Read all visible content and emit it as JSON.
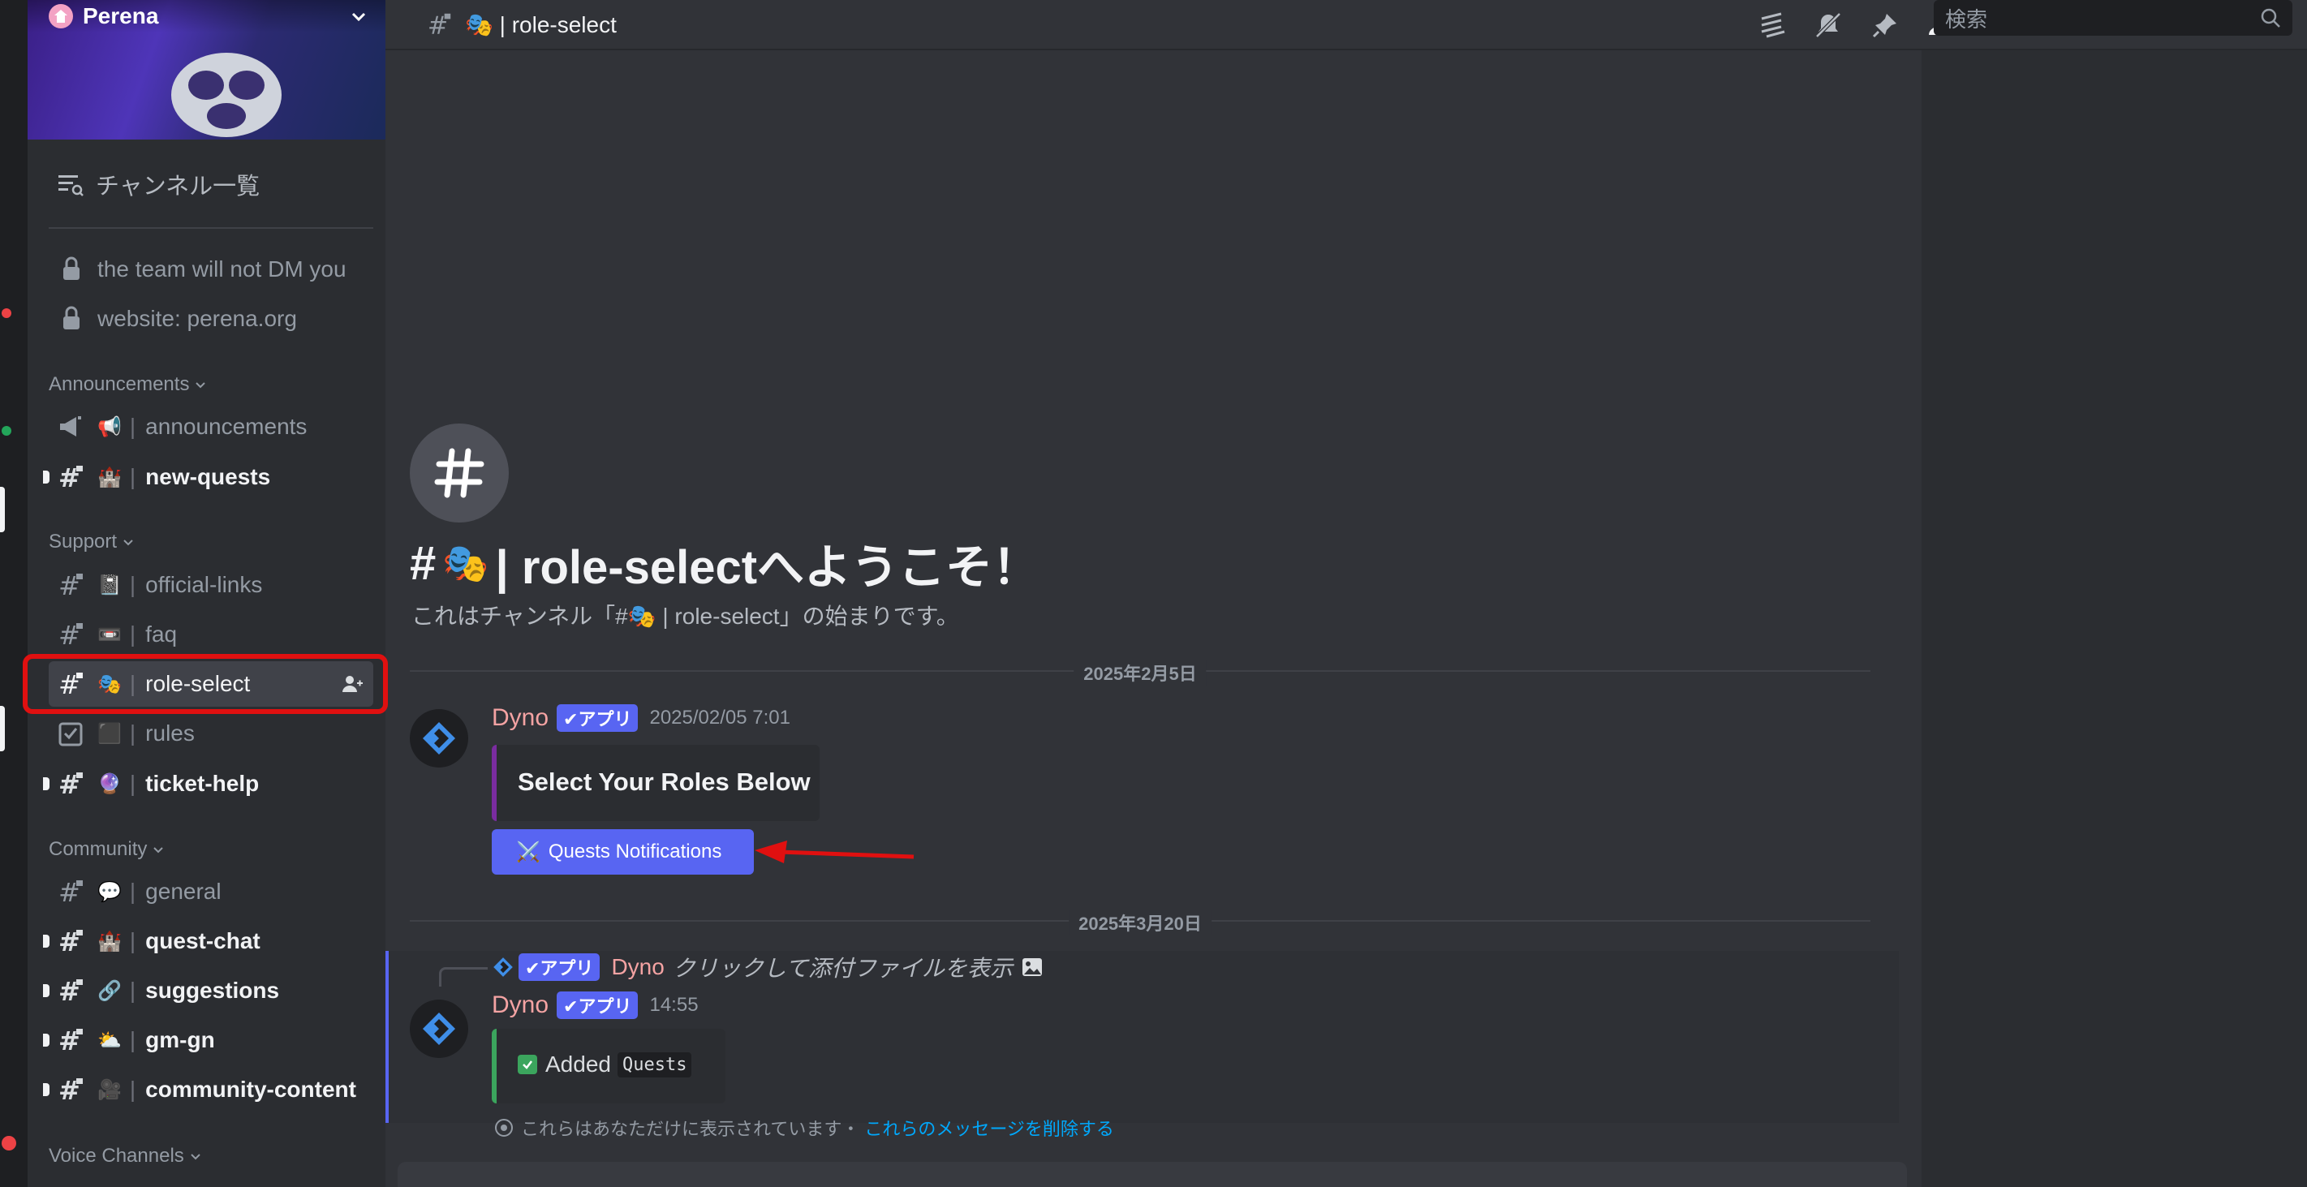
{
  "server": {
    "name": "Perena"
  },
  "sidebar": {
    "browse_label": "チャンネル一覧",
    "pinned": [
      {
        "label": "the team will not DM you"
      },
      {
        "label": "website: perena.org"
      }
    ],
    "categories": [
      {
        "label": "Announcements"
      },
      {
        "label": "Support"
      },
      {
        "label": "Community"
      },
      {
        "label": "Voice Channels"
      }
    ],
    "channels": [
      {
        "emoji": "📢",
        "label": "announcements"
      },
      {
        "emoji": "🏰",
        "label": "new-quests"
      },
      {
        "emoji": "📓",
        "label": "official-links"
      },
      {
        "emoji": "📼",
        "label": "faq"
      },
      {
        "emoji": "🎭",
        "label": "role-select"
      },
      {
        "emoji": "⬛",
        "label": "rules"
      },
      {
        "emoji": "🔮",
        "label": "ticket-help"
      },
      {
        "emoji": "💬",
        "label": "general"
      },
      {
        "emoji": "🏰",
        "label": "quest-chat"
      },
      {
        "emoji": "🔗",
        "label": "suggestions"
      },
      {
        "emoji": "⛅",
        "label": "gm-gn"
      },
      {
        "emoji": "🎥",
        "label": "community-content"
      }
    ],
    "separator": "|"
  },
  "topbar": {
    "channel_title": "🎭 | role-select",
    "search_placeholder": "検索"
  },
  "welcome": {
    "title_prefix": "#",
    "title_emoji": "🎭",
    "title_text": "| role-selectへようこそ！",
    "subtitle": "これはチャンネル「#🎭 | role-select」の始まりです。"
  },
  "messages": [
    {
      "date_divider": "2025年2月5日",
      "author": "Dyno",
      "badge": "✔アプリ",
      "timestamp": "2025/02/05 7:01",
      "embed_title": "Select Your Roles Below",
      "button_emoji": "⚔️",
      "button_label": "Quests Notifications"
    },
    {
      "date_divider": "2025年3月20日",
      "reply_author": "Dyno",
      "reply_badge": "✔アプリ",
      "reply_text": "クリックして添付ファイルを表示",
      "author": "Dyno",
      "badge": "✔アプリ",
      "timestamp": "14:55",
      "embed_text": "Added",
      "embed_code": "Quests",
      "ephemeral_note": "これらはあなただけに表示されています・",
      "ephemeral_link": "これらのメッセージを削除する"
    }
  ],
  "colors": {
    "accent": "#5865f2",
    "highlight": "#e01010",
    "username": "#f4a3a3",
    "link": "#00a8fc"
  }
}
